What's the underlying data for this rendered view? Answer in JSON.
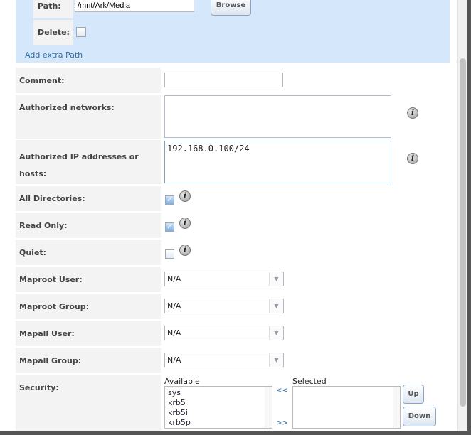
{
  "paths": {
    "path_label": "Path:",
    "path_value": "/mnt/Ark/Media",
    "browse": "Browse",
    "delete_label": "Delete:",
    "add_extra": "Add extra Path"
  },
  "form": {
    "comment": "Comment:",
    "comment_value": "",
    "auth_networks": "Authorized networks:",
    "auth_networks_value": "",
    "auth_ip": "Authorized IP addresses or hosts:",
    "auth_ip_value": "192.168.0.100/24",
    "all_dirs": "All Directories:",
    "read_only": "Read Only:",
    "quiet": "Quiet:",
    "maproot_user": "Maproot User:",
    "maproot_user_value": "N/A",
    "maproot_group": "Maproot Group:",
    "maproot_group_value": "N/A",
    "mapall_user": "Mapall User:",
    "mapall_user_value": "N/A",
    "mapall_group": "Mapall Group:",
    "mapall_group_value": "N/A",
    "security": "Security:",
    "available": "Available",
    "selected": "Selected",
    "available_items": [
      "sys",
      "krb5",
      "krb5i",
      "krb5p"
    ],
    "move_left": "<<",
    "move_right": ">>",
    "up": "Up",
    "down": "Down"
  },
  "info_glyph": "i"
}
